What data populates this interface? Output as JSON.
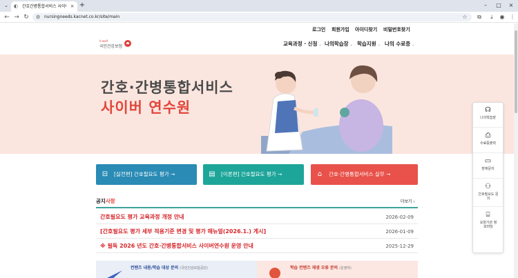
{
  "browser": {
    "tab_title": "간호간병통합서비스 사이버연",
    "url": "nursingneeds.kacnet.co.kr/site/main"
  },
  "utility_nav": [
    "로그인",
    "회원가입",
    "아이디찾기",
    "비밀번호찾기"
  ],
  "logo": {
    "en": "h-well",
    "ko": "국민건강보험"
  },
  "gnb": [
    {
      "label": "교육과정 · 신청"
    },
    {
      "label": "나의학습장"
    },
    {
      "label": "학습지원"
    },
    {
      "label": "나의 수료증"
    }
  ],
  "hero": {
    "line1": "간호·간병통합서비스",
    "line2": "사이버 연수원"
  },
  "quick_buttons": [
    {
      "label": "[실전편] 간호필요도 평가 →",
      "color": "#2a8bb5"
    },
    {
      "label": "[이론편] 간호필요도 평가 →",
      "color": "#1ea59a"
    },
    {
      "label": "간호·간병통합서비스 실무 →",
      "color": "#e8524a"
    }
  ],
  "notice": {
    "title_main": "공지",
    "title_accent": "사항",
    "more": "더보기 ›",
    "items": [
      {
        "text": "간호필요도 평가 교육과정 개정 안내",
        "date": "2026-02-09"
      },
      {
        "text": "[간호필요도 평가 세부 적용기준 변경 및 평가 매뉴얼(2026.1.) 게시]",
        "date": "2026-01-09"
      },
      {
        "text": "※ 필독 2026 년도 간호·간병통합서비스 사이버연수원 운영 안내",
        "date": "2025-12-29"
      }
    ]
  },
  "contact": {
    "left_title": "컨텐츠 내용/학습 대상 문의",
    "left_sub": "(국민건강보험공단)",
    "right_title": "학습 컨텐츠 재생 오류 문의",
    "right_sub": "(운영자)"
  },
  "quick_side": [
    "나의학습장",
    "수료증출력",
    "장애문의",
    "간호필요도 문의",
    "요양기관 정보마당"
  ],
  "colors": {
    "accent_red": "#e2463b",
    "teal": "#3aa39a",
    "hero_bg": "#fbe6df"
  }
}
